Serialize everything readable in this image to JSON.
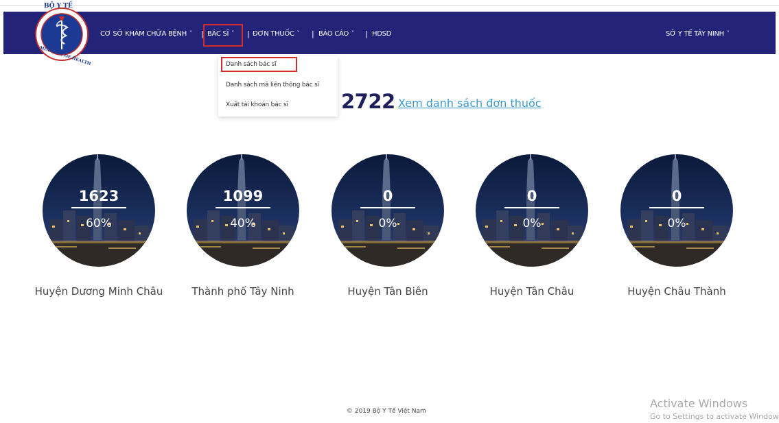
{
  "logo": {
    "top_text": "BỘ Y TẾ",
    "ring_text": "MINISTRY OF HEALTH"
  },
  "nav": {
    "items": [
      {
        "label": "CƠ SỞ KHÁM CHỮA BỆNH",
        "chevron": "˅"
      },
      {
        "label": "BÁC SĨ",
        "chevron": "˅"
      },
      {
        "label": "ĐƠN THUỐC",
        "chevron": "˅"
      },
      {
        "label": "BÁO CÁO",
        "chevron": "˅"
      },
      {
        "label": "HDSD"
      }
    ],
    "separator": "|",
    "user_menu": {
      "label": "SỞ Y TẾ TÂY NINH",
      "chevron": "˅"
    }
  },
  "dropdown": {
    "items": [
      "Danh sách bác sĩ",
      "Danh sách mã liên thông bác sĩ",
      "Xuất tài khoản bác sĩ"
    ]
  },
  "summary": {
    "total": "2722",
    "link_label": "Xem danh sách đơn thuốc"
  },
  "districts": [
    {
      "count": "1623",
      "percent": "60%",
      "name": "Huyện Dương Minh Châu"
    },
    {
      "count": "1099",
      "percent": "40%",
      "name": "Thành phố Tây Ninh"
    },
    {
      "count": "0",
      "percent": "0%",
      "name": "Huyện Tân Biên"
    },
    {
      "count": "0",
      "percent": "0%",
      "name": "Huyện Tân Châu"
    },
    {
      "count": "0",
      "percent": "0%",
      "name": "Huyện Châu Thành"
    }
  ],
  "footer": {
    "copyright": "© 2019 Bộ Y Tế Việt Nam"
  },
  "watermark": {
    "title": "Activate Windows",
    "subtitle": "Go to Settings to activate Windows."
  },
  "colors": {
    "navbar": "#23237a",
    "highlight": "#d42b2b",
    "link": "#3a9ad0",
    "total": "#1f1f5c"
  }
}
